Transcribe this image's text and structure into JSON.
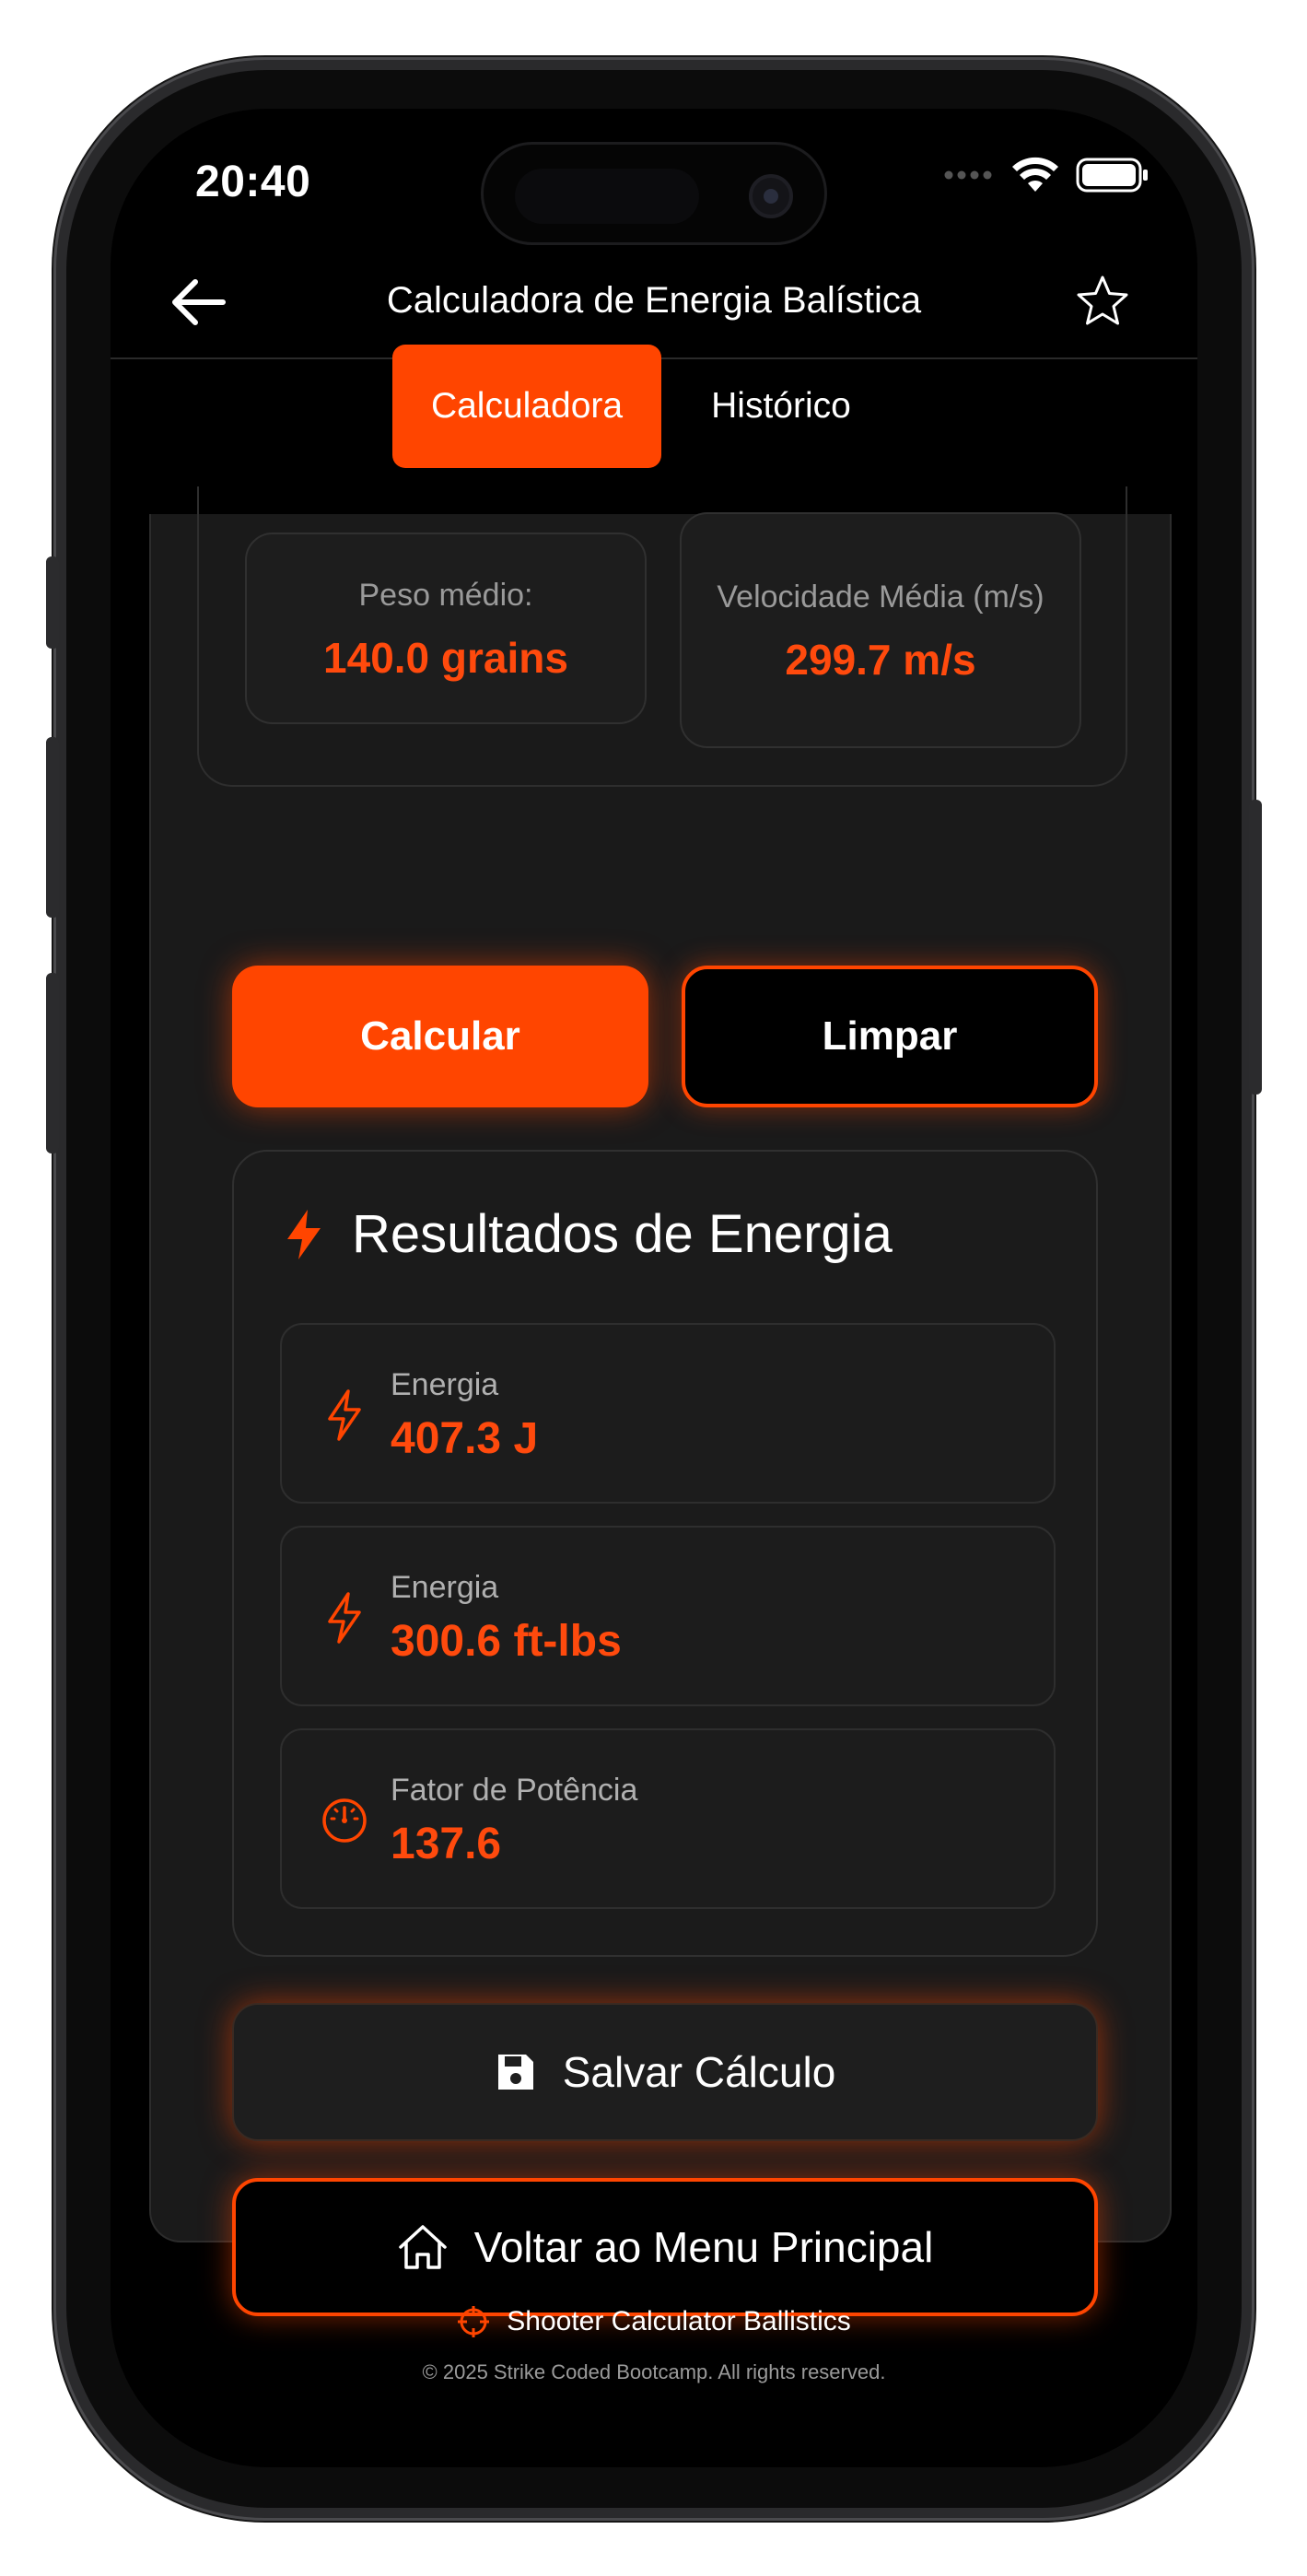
{
  "status_bar": {
    "time": "20:40"
  },
  "header": {
    "title": "Calculadora de Energia Balística"
  },
  "tabs": [
    {
      "label": "Calculadora",
      "active": true
    },
    {
      "label": "Histórico",
      "active": false
    }
  ],
  "stats": {
    "weight": {
      "label": "Peso médio:",
      "value": "140.0 grains"
    },
    "velocity": {
      "label": "Velocidade Média (m/s)",
      "value": "299.7 m/s"
    }
  },
  "actions": {
    "calculate": "Calcular",
    "clear": "Limpar"
  },
  "results": {
    "title": "Resultados de Energia",
    "items": [
      {
        "label": "Energia",
        "value": "407.3 J",
        "icon": "lightning-icon"
      },
      {
        "label": "Energia",
        "value": "300.6 ft-lbs",
        "icon": "lightning-icon"
      },
      {
        "label": "Fator de Potência",
        "value": "137.6",
        "icon": "gauge-icon"
      }
    ]
  },
  "buttons": {
    "save": "Salvar Cálculo",
    "home": "Voltar ao Menu Principal"
  },
  "footer": {
    "brand": "Shooter Calculator Ballistics",
    "copyright": "© 2025 Strike Coded Bootcamp. All rights reserved."
  },
  "colors": {
    "accent": "#ff4500",
    "background": "#000000",
    "card": "#1a1a1a"
  }
}
